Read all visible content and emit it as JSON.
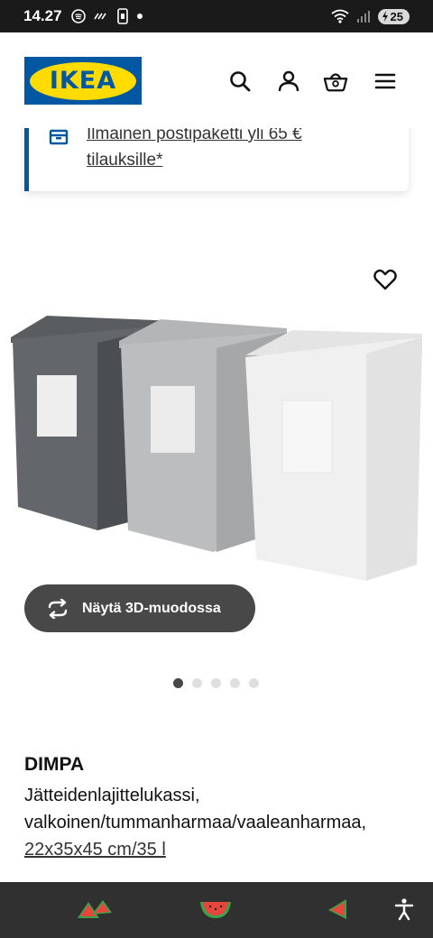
{
  "status_bar": {
    "time": "14.27",
    "battery": "25"
  },
  "header": {
    "logo_text": "IKEA",
    "icons": [
      "search-icon",
      "account-icon",
      "basket-icon",
      "menu-icon"
    ]
  },
  "promo": {
    "text": "Ilmainen postipaketti yli 65 € tilauksille*"
  },
  "product": {
    "name": "DIMPA",
    "description": "Jätteidenlajittelukassi, valkoinen/tummanharmaa/vaaleanharmaa,",
    "dimensions": "22x35x45 cm/35 l",
    "view_3d_label": "Näytä 3D-muodossa",
    "carousel": {
      "total": 5,
      "active": 1
    }
  },
  "colors": {
    "ikea_blue": "#0058a3",
    "ikea_yellow": "#ffdb00",
    "button_dark": "#484848"
  }
}
